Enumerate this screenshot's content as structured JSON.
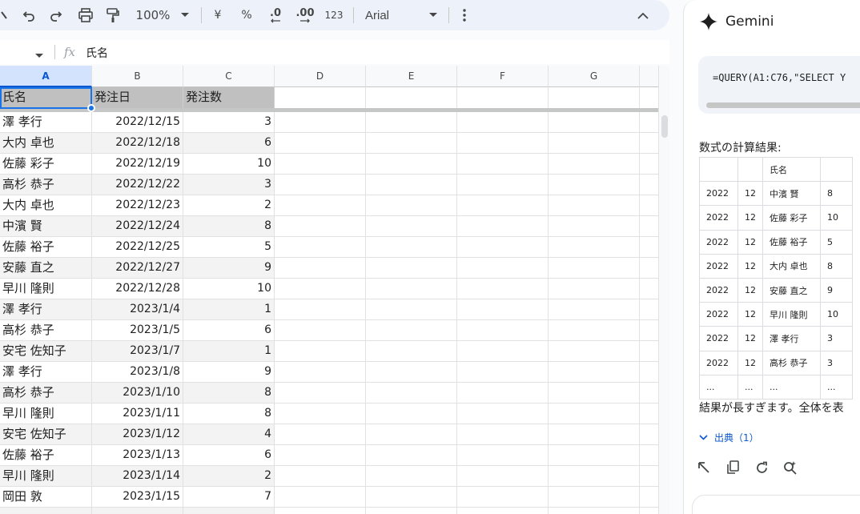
{
  "toolbar": {
    "zoom": "100%",
    "currency": "¥",
    "percent": "%",
    "decrease_decimal": ".0",
    "increase_decimal": ".00",
    "number_format": "123",
    "font": "Arial"
  },
  "formula_bar": {
    "fx": "fx",
    "value": "氏名"
  },
  "sheet": {
    "columns": [
      "A",
      "B",
      "C",
      "D",
      "E",
      "F",
      "G"
    ],
    "header_row": [
      "氏名",
      "発注日",
      "発注数"
    ],
    "rows": [
      [
        "澤 孝行",
        "2022/12/15",
        "3"
      ],
      [
        "大内 卓也",
        "2022/12/18",
        "6"
      ],
      [
        "佐藤 彩子",
        "2022/12/19",
        "10"
      ],
      [
        "高杉 恭子",
        "2022/12/22",
        "3"
      ],
      [
        "大内 卓也",
        "2022/12/23",
        "2"
      ],
      [
        "中濱 賢",
        "2022/12/24",
        "8"
      ],
      [
        "佐藤 裕子",
        "2022/12/25",
        "5"
      ],
      [
        "安藤 直之",
        "2022/12/27",
        "9"
      ],
      [
        "早川 隆則",
        "2022/12/28",
        "10"
      ],
      [
        "澤 孝行",
        "2023/1/4",
        "1"
      ],
      [
        "高杉 恭子",
        "2023/1/5",
        "6"
      ],
      [
        "安宅 佐知子",
        "2023/1/7",
        "1"
      ],
      [
        "澤 孝行",
        "2023/1/8",
        "9"
      ],
      [
        "高杉 恭子",
        "2023/1/10",
        "8"
      ],
      [
        "早川 隆則",
        "2023/1/11",
        "8"
      ],
      [
        "安宅 佐知子",
        "2023/1/12",
        "4"
      ],
      [
        "佐藤 裕子",
        "2023/1/13",
        "6"
      ],
      [
        "早川 隆則",
        "2023/1/14",
        "2"
      ],
      [
        "岡田 敦",
        "2023/1/15",
        "7"
      ]
    ]
  },
  "gemini": {
    "title": "Gemini",
    "code": "=QUERY(A1:C76,\"SELECT Y",
    "result_label": "数式の計算結果:",
    "result_header": [
      "",
      "",
      "氏名",
      ""
    ],
    "result_rows": [
      [
        "2022",
        "12",
        "中濱 賢",
        "8"
      ],
      [
        "2022",
        "12",
        "佐藤 彩子",
        "10"
      ],
      [
        "2022",
        "12",
        "佐藤 裕子",
        "5"
      ],
      [
        "2022",
        "12",
        "大内 卓也",
        "8"
      ],
      [
        "2022",
        "12",
        "安藤 直之",
        "9"
      ],
      [
        "2022",
        "12",
        "早川 隆則",
        "10"
      ],
      [
        "2022",
        "12",
        "澤 孝行",
        "3"
      ],
      [
        "2022",
        "12",
        "高杉 恭子",
        "3"
      ],
      [
        "...",
        "...",
        "...",
        "..."
      ]
    ],
    "long_note": "結果が長すぎます。全体を表",
    "sources_label": "出典（1）"
  }
}
